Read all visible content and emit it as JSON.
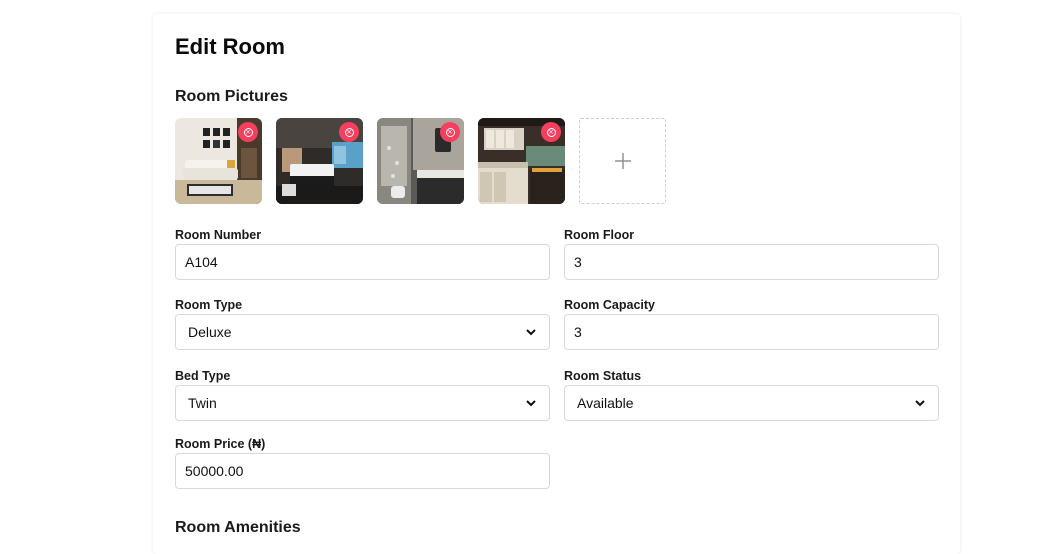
{
  "page": {
    "title": "Edit Room"
  },
  "pictures": {
    "heading": "Room Pictures",
    "items": [
      {
        "alt": "living room photo",
        "remove_icon": "circle-x-icon"
      },
      {
        "alt": "bedroom photo",
        "remove_icon": "circle-x-icon"
      },
      {
        "alt": "bathroom photo",
        "remove_icon": "circle-x-icon"
      },
      {
        "alt": "kitchen photo",
        "remove_icon": "circle-x-icon"
      }
    ],
    "add_icon": "plus-icon",
    "remove_color": "#f43f5e"
  },
  "form": {
    "room_number": {
      "label": "Room Number",
      "value": "A104"
    },
    "room_floor": {
      "label": "Room Floor",
      "value": "3"
    },
    "room_type": {
      "label": "Room Type",
      "value": "Deluxe"
    },
    "room_capacity": {
      "label": "Room Capacity",
      "value": "3"
    },
    "bed_type": {
      "label": "Bed Type",
      "value": "Twin"
    },
    "room_status": {
      "label": "Room Status",
      "value": "Available"
    },
    "room_price": {
      "label": "Room Price (₦)",
      "value": "50000.00"
    }
  },
  "amenities": {
    "heading": "Room Amenities"
  }
}
